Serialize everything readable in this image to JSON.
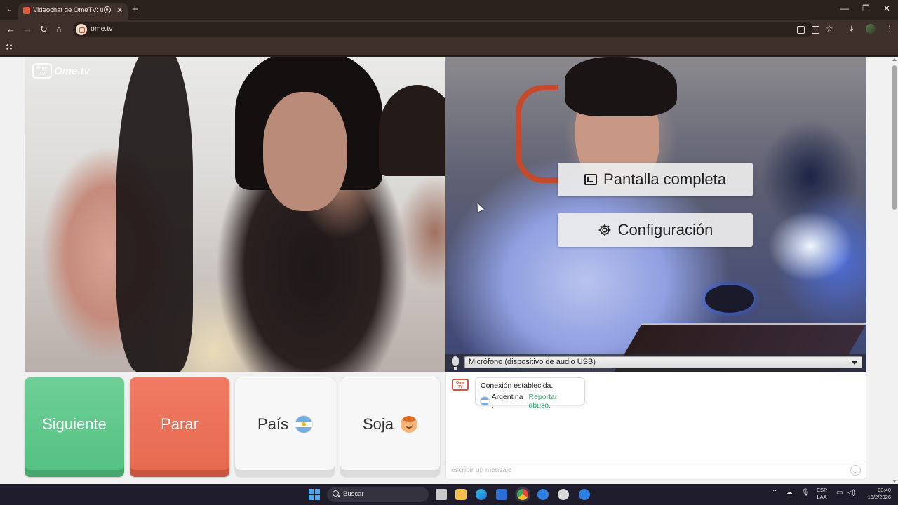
{
  "browser": {
    "tab_title": "Videochat de OmeTV: una",
    "url": "ome.tv"
  },
  "page": {
    "logo_text": "Ome.tv",
    "logo_badge": "Ome TV",
    "overlay": {
      "fullscreen_label": "Pantalla completa",
      "settings_label": "Configuración"
    },
    "microphone": {
      "selected": "Micrófono (dispositivo de audio USB)"
    },
    "controls": {
      "next_label": "Siguiente",
      "stop_label": "Parar",
      "country_label": "País",
      "gender_label": "Soja"
    },
    "chat": {
      "system_message": "Conexión establecida.",
      "country": "Argentina .",
      "report_link": "Reportar abuso.",
      "input_placeholder": "escribir un mensaje"
    }
  },
  "taskbar": {
    "search_placeholder": "Buscar",
    "lang_line1": "ESP",
    "lang_line2": "LAA",
    "time": "03:40",
    "date": "16/2/2026"
  },
  "colors": {
    "next_button": "#53c081",
    "stop_button": "#e5694f",
    "report_link": "#3aa26c",
    "browser_frame": "#2b211c"
  }
}
